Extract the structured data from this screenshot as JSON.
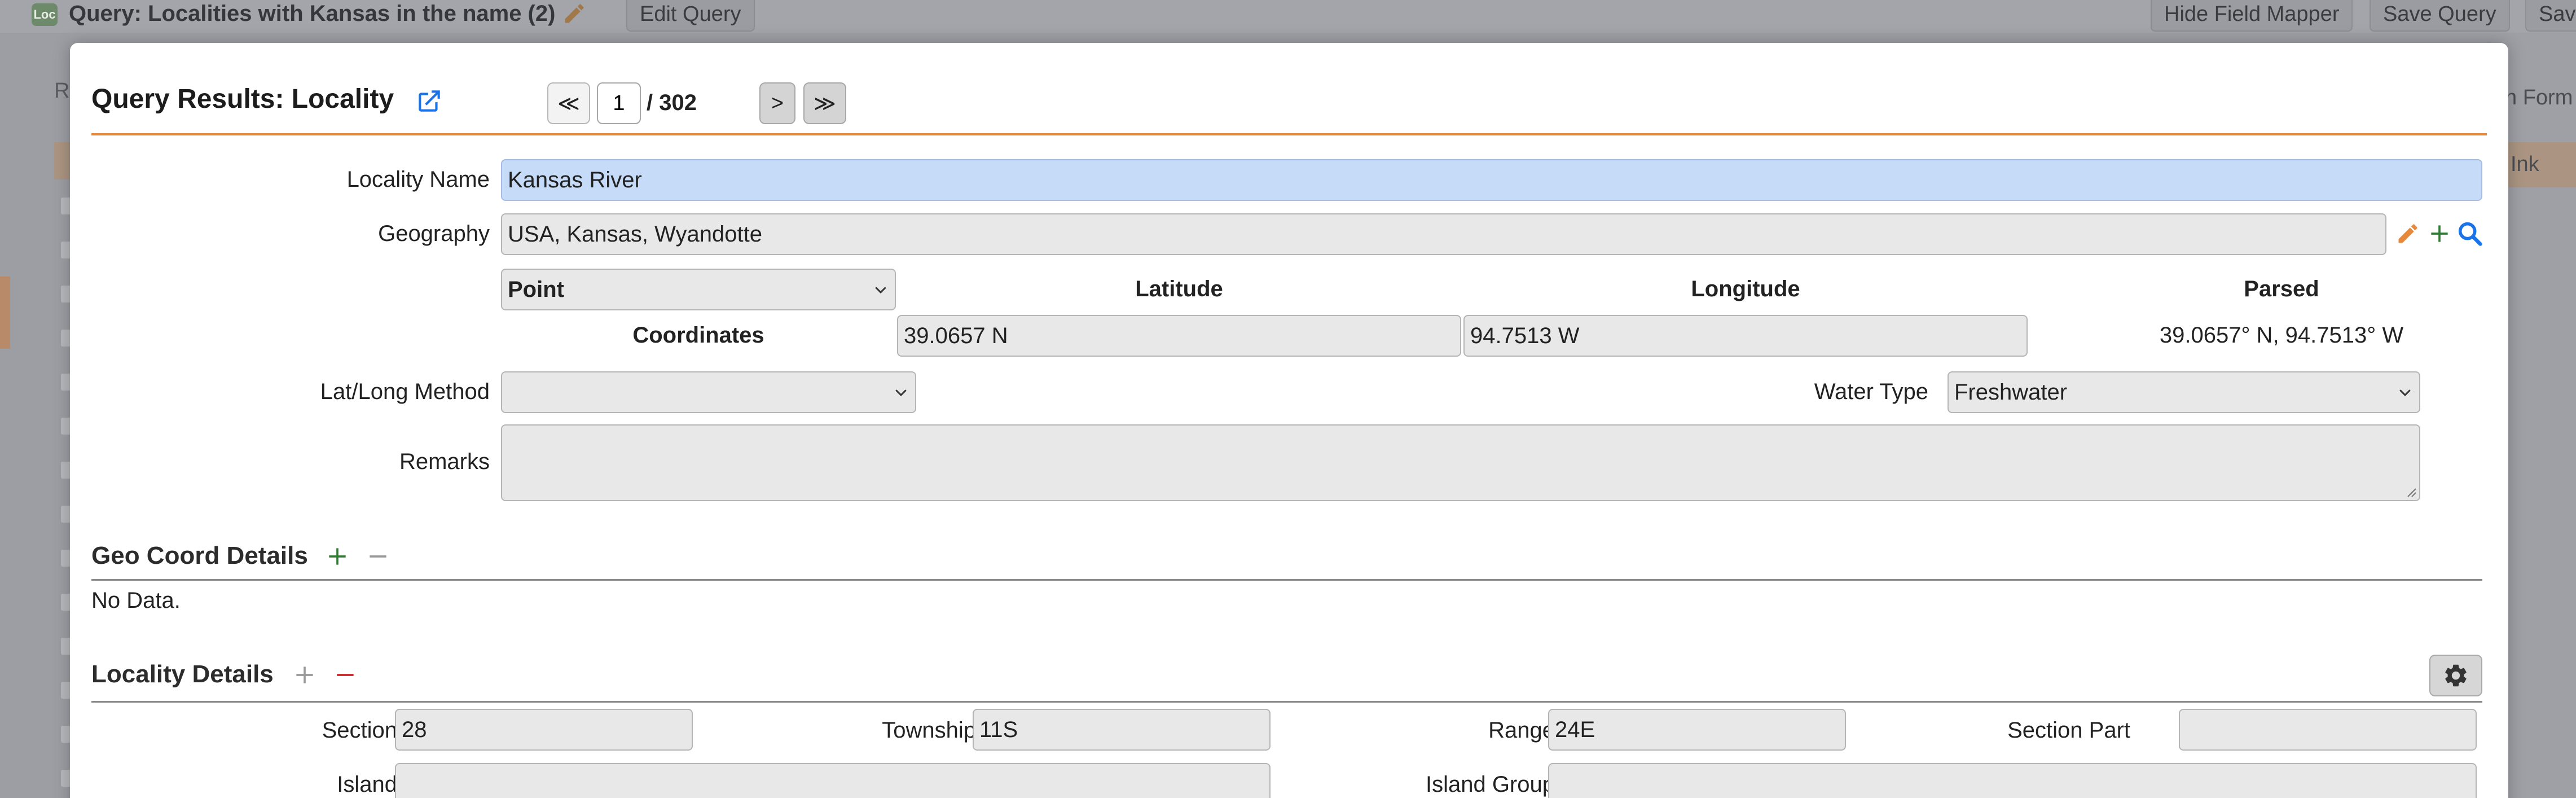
{
  "background": {
    "logo_text": "Loc",
    "title": "Query: Localities with Kansas in the name (2)",
    "edit_query_label": "Edit Query",
    "hide_field_mapper_label": "Hide Field Mapper",
    "save_query_label": "Save Query",
    "save_truncated_label": "Save",
    "left_r": "R",
    "right_form_text": "n Form",
    "right_link_text": "Ink"
  },
  "modal": {
    "title": "Query Results: Locality",
    "nav": {
      "first_label": "≪",
      "prev_label": "<",
      "current_page": "1",
      "total": "/ 302",
      "next_label": ">",
      "last_label": "≫"
    },
    "form": {
      "locality_name_label": "Locality Name",
      "locality_name_value": "Kansas River",
      "geography_label": "Geography",
      "geography_value": "USA, Kansas, Wyandotte",
      "coord_type_value": "Point",
      "latitude_header": "Latitude",
      "longitude_header": "Longitude",
      "parsed_header": "Parsed",
      "coordinates_label": "Coordinates",
      "latitude_value": "39.0657 N",
      "longitude_value": "94.7513 W",
      "parsed_value": "39.0657° N, 94.7513° W",
      "latlong_method_label": "Lat/Long Method",
      "latlong_method_value": "",
      "water_type_label": "Water Type",
      "water_type_value": "Freshwater",
      "remarks_label": "Remarks",
      "remarks_value": ""
    },
    "geo_coord_details": {
      "title": "Geo Coord Details",
      "empty_text": "No Data."
    },
    "locality_details": {
      "title": "Locality Details",
      "section_label": "Section",
      "section_value": "28",
      "township_label": "Township",
      "township_value": "11S",
      "range_label": "Range",
      "range_value": "24E",
      "section_part_label": "Section Part",
      "section_part_value": "",
      "island_label": "Island",
      "island_value": "",
      "island_group_label": "Island Group",
      "island_group_value": ""
    }
  },
  "colors": {
    "accent_orange": "#e8883a",
    "add_green": "#2e7d32",
    "remove_red": "#c62828",
    "link_blue": "#1a73e8",
    "highlight_field": "#c6dbf7"
  }
}
